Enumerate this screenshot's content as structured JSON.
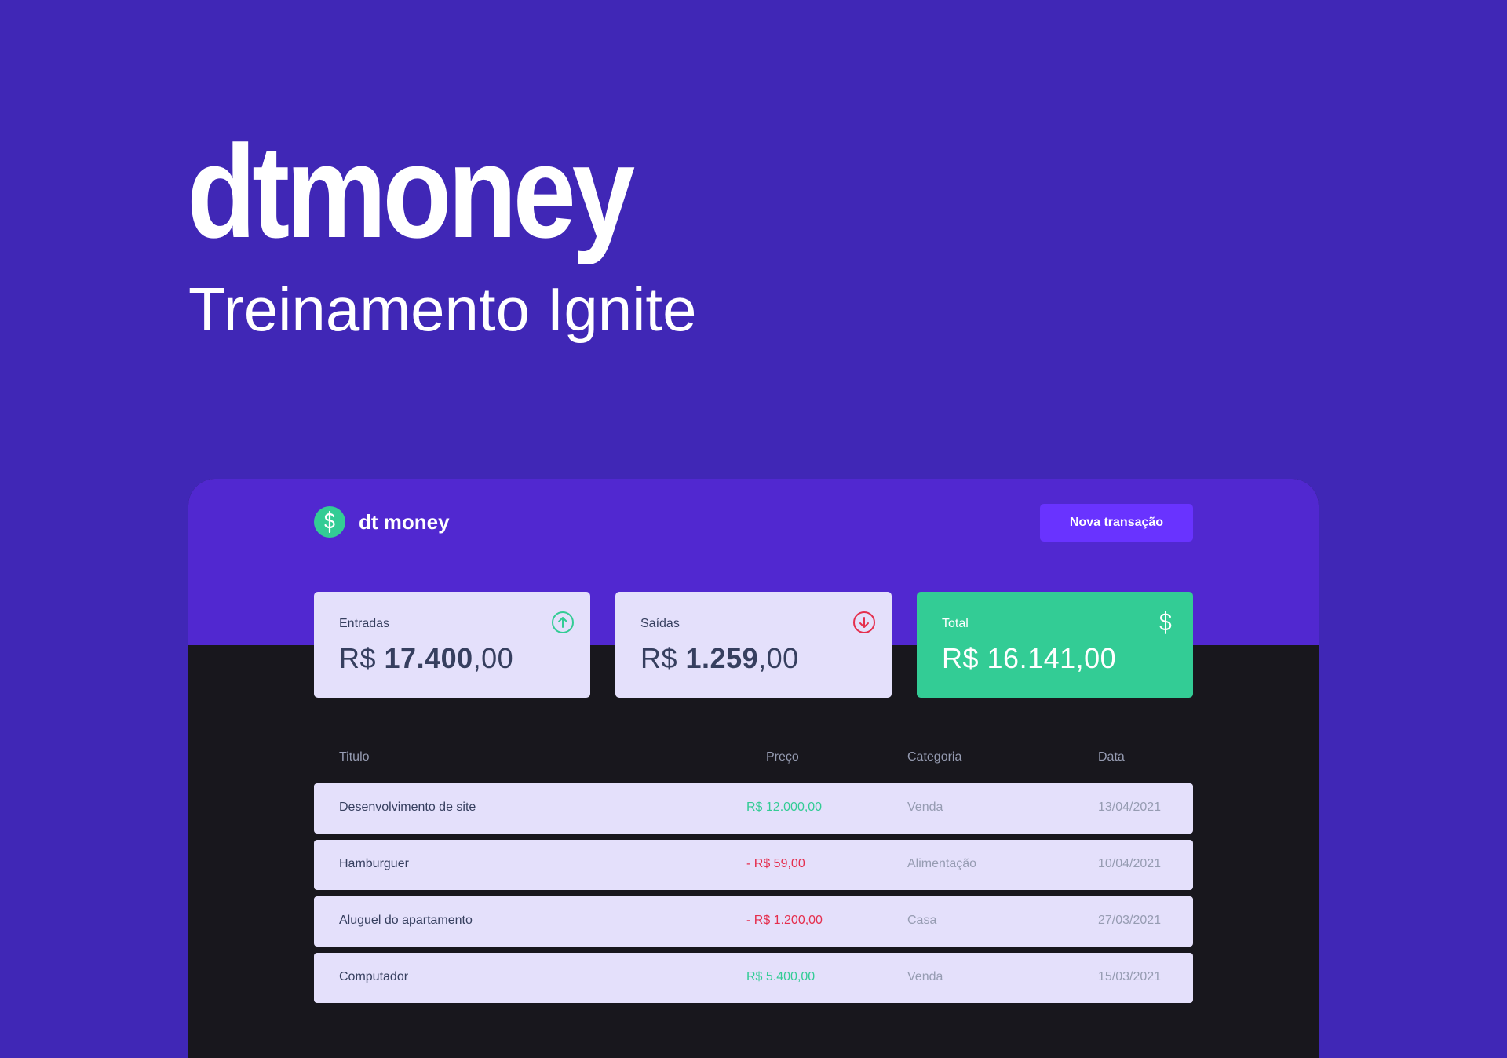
{
  "hero": {
    "title": "dtmoney",
    "subtitle": "Treinamento Ignite"
  },
  "app": {
    "brand": "dt money",
    "new_transaction_label": "Nova transação",
    "colors": {
      "background": "#4027b6",
      "header": "#5128d0",
      "card": "#e4e0fb",
      "green": "#33cc95",
      "red": "#e52e4d",
      "button": "#6933ff",
      "dark": "#18171d"
    },
    "summary": {
      "income": {
        "label": "Entradas",
        "prefix": "R$ ",
        "value_strong": "17.400",
        "value_rest": ",00",
        "icon": "arrow-up-circle-icon"
      },
      "outcome": {
        "label": "Saídas",
        "prefix": "R$ ",
        "value_strong": "1.259",
        "value_rest": ",00",
        "icon": "arrow-down-circle-icon"
      },
      "total": {
        "label": "Total",
        "value": "R$ 16.141,00",
        "icon": "dollar-icon"
      }
    },
    "table": {
      "headers": {
        "title": "Titulo",
        "price": "Preço",
        "category": "Categoria",
        "date": "Data"
      },
      "rows": [
        {
          "title": "Desenvolvimento de site",
          "price": "R$ 12.000,00",
          "type": "income",
          "category": "Venda",
          "date": "13/04/2021"
        },
        {
          "title": "Hamburguer",
          "price": "- R$ 59,00",
          "type": "outcome",
          "category": "Alimentação",
          "date": "10/04/2021"
        },
        {
          "title": "Aluguel do apartamento",
          "price": "- R$ 1.200,00",
          "type": "outcome",
          "category": "Casa",
          "date": "27/03/2021"
        },
        {
          "title": "Computador",
          "price": "R$ 5.400,00",
          "type": "income",
          "category": "Venda",
          "date": "15/03/2021"
        }
      ]
    }
  }
}
